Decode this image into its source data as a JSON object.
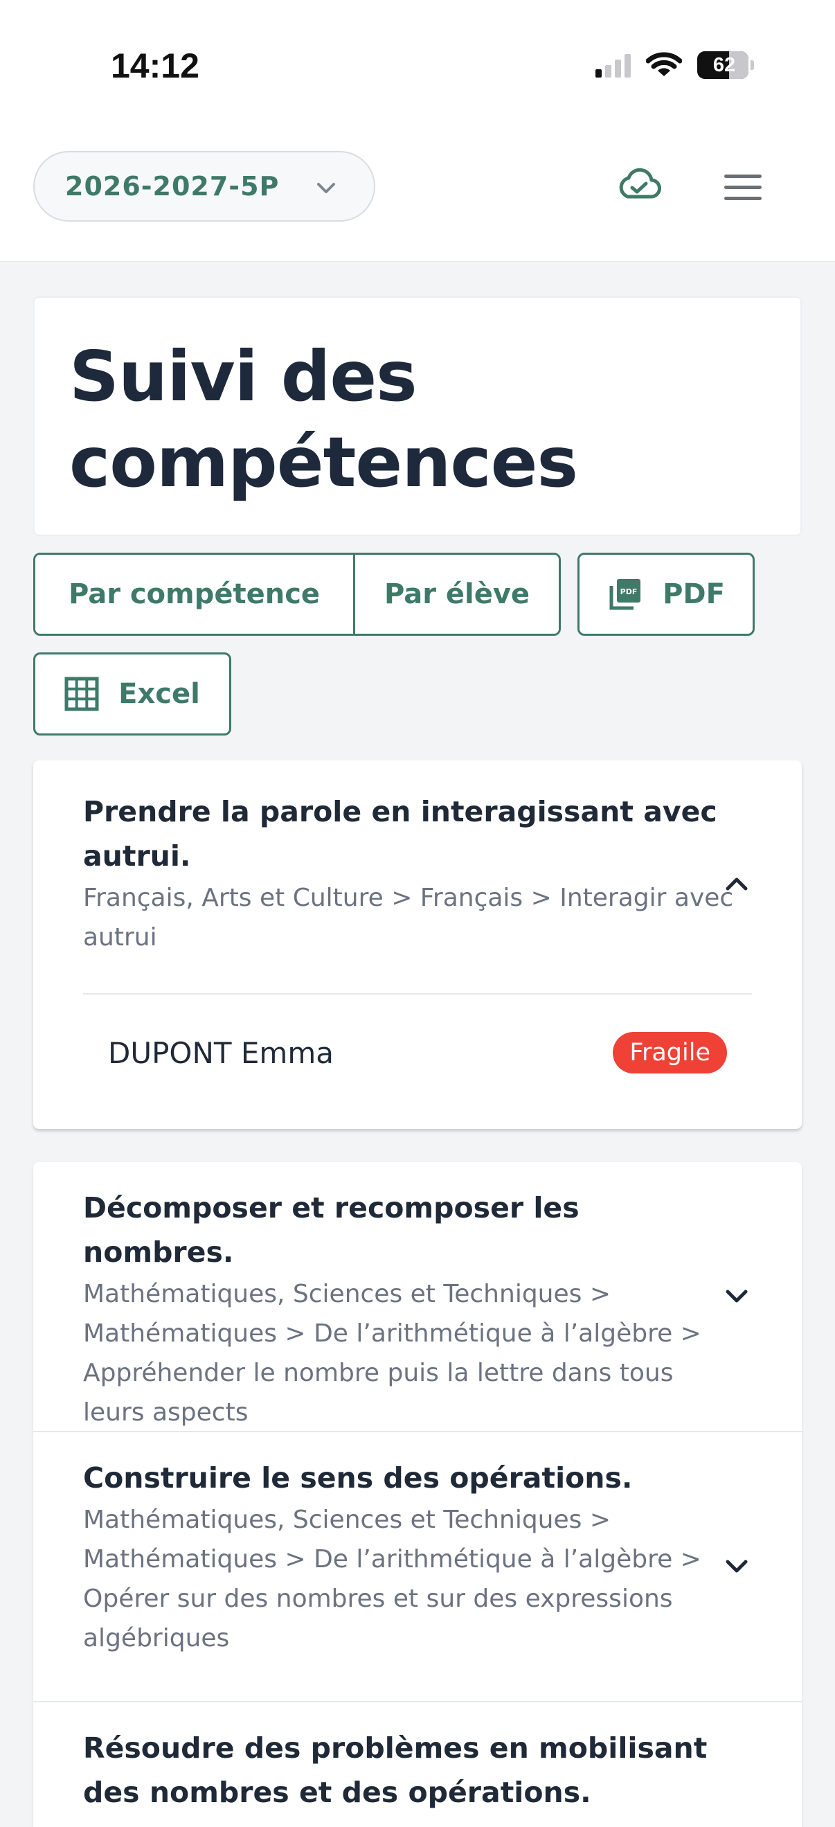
{
  "status_bar": {
    "time": "14:12",
    "battery": "62",
    "icons": [
      "cellular-signal-icon",
      "wifi-icon",
      "battery-icon"
    ]
  },
  "header": {
    "class_selector": "2026-2027-5P",
    "icons": [
      "chevron-down-icon",
      "cloud-check-icon",
      "menu-icon"
    ]
  },
  "page": {
    "title": "Suivi des compétences"
  },
  "view_toggle": {
    "by_competence": "Par compétence",
    "by_student": "Par élève"
  },
  "export": {
    "pdf_label": "PDF",
    "excel_label": "Excel"
  },
  "competences": [
    {
      "title": "Prendre la parole en interagissant avec autrui.",
      "path": "Français, Arts et Culture > Français > Interagir avec autrui",
      "expanded": true,
      "students": [
        {
          "name": "DUPONT Emma",
          "status": "Fragile"
        }
      ]
    },
    {
      "title": "Décomposer et recomposer les nombres.",
      "path": "Mathématiques, Sciences et Techniques > Mathématiques > De l’arithmétique à l’algèbre > Appréhender le nombre puis la lettre dans tous leurs aspects",
      "expanded": false
    },
    {
      "title": "Construire le sens des opérations.",
      "path": "Mathématiques, Sciences et Techniques > Mathématiques > De l’arithmétique à l’algèbre > Opérer sur des nombres et sur des expressions algébriques",
      "expanded": false
    },
    {
      "title": "Résoudre des problèmes en mobilisant des nombres et des opérations.",
      "path": "",
      "expanded": false
    }
  ],
  "colors": {
    "accent": "#3e7a67",
    "title_text": "#1e293b",
    "muted_text": "#6b7280",
    "badge_fragile": "#ef4136",
    "background": "#f3f4f6"
  }
}
